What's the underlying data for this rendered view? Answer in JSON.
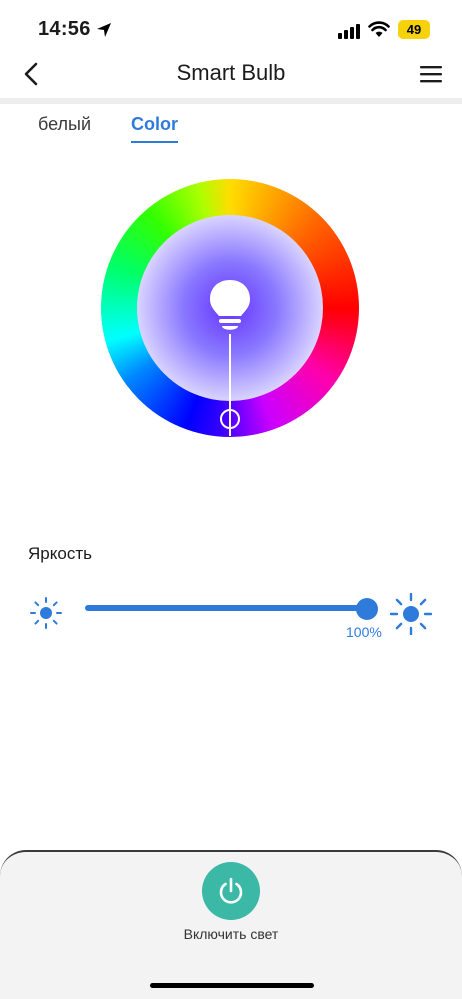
{
  "status_bar": {
    "time": "14:56",
    "battery": "49",
    "battery_color": "#f6d20c",
    "icons": [
      "location-arrow-icon",
      "cellular-signal-icon",
      "wifi-icon",
      "battery-icon"
    ]
  },
  "nav": {
    "title": "Smart Bulb",
    "back_icon": "chevron-left-icon",
    "menu_icon": "hamburger-menu-icon"
  },
  "tabs": {
    "white_label": "белый",
    "color_label": "Color",
    "active": "Color"
  },
  "color_picker": {
    "center_icon": "light-bulb-icon",
    "selected_color": "#6633ff"
  },
  "brightness": {
    "label": "Яркость",
    "value": 100,
    "value_label": "100%",
    "min_icon": "sun-small-icon",
    "max_icon": "sun-large-icon"
  },
  "power": {
    "label": "Включить свет",
    "icon": "power-icon",
    "button_color": "#3bb8a6"
  },
  "colors": {
    "accent": "#2f7bdc",
    "power": "#3bb8a6"
  }
}
